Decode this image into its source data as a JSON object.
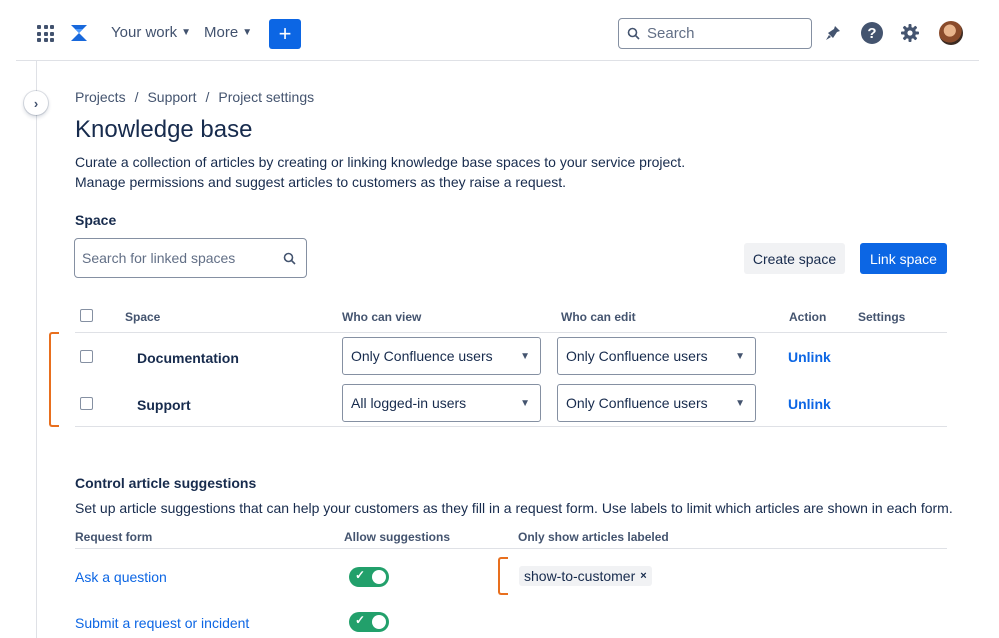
{
  "nav": {
    "your_work": "Your work",
    "more": "More",
    "create": "+",
    "search_placeholder": "Search",
    "help": "?"
  },
  "breadcrumb": [
    "Projects",
    "Support",
    "Project settings"
  ],
  "breadcrumb_sep": "/",
  "page": {
    "title": "Knowledge base",
    "desc_line1": "Curate a collection of articles by creating or linking knowledge base spaces to your service project.",
    "desc_line2": "Manage permissions and suggest articles to customers as they raise a request."
  },
  "space": {
    "label": "Space",
    "search_placeholder": "Search for linked spaces",
    "create_button": "Create space",
    "link_button": "Link space",
    "columns": {
      "space": "Space",
      "who_can_view": "Who can view",
      "who_can_edit": "Who can edit",
      "action": "Action",
      "settings": "Settings"
    },
    "rows": [
      {
        "name": "Documentation",
        "view": "Only Confluence users",
        "edit": "Only Confluence users",
        "action": "Unlink"
      },
      {
        "name": "Support",
        "view": "All logged-in users",
        "edit": "Only Confluence users",
        "action": "Unlink"
      }
    ]
  },
  "suggestions": {
    "title": "Control article suggestions",
    "desc": "Set up article suggestions that can help your customers as they fill in a request form. Use labels to limit which articles are shown in each form.",
    "columns": {
      "request_form": "Request form",
      "allow": "Allow suggestions",
      "labels": "Only show articles labeled"
    },
    "rows": [
      {
        "form": "Ask a question",
        "allow": true,
        "label": "show-to-customer"
      },
      {
        "form": "Submit a request or incident",
        "allow": true,
        "label": ""
      }
    ],
    "tag_remove": "×"
  },
  "colors": {
    "primary": "#0c66e4",
    "toggle_on": "#22a06b",
    "highlight": "#e86f1e"
  }
}
